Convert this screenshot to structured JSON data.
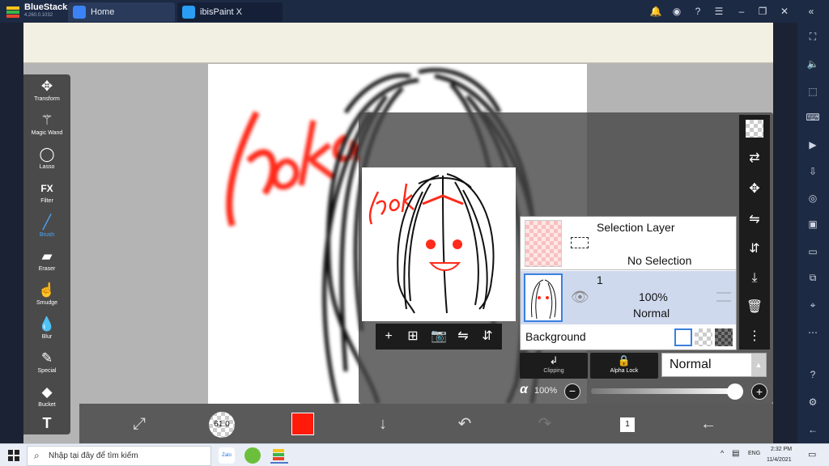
{
  "window": {
    "brand": "BlueStacks",
    "version": "4.260.0.1032",
    "tabs": [
      {
        "label": "Home"
      },
      {
        "label": "ibisPaint X"
      }
    ]
  },
  "tools": [
    {
      "label": "Transform",
      "icon": "move-arrows-icon"
    },
    {
      "label": "Magic Wand",
      "icon": "magic-wand-icon"
    },
    {
      "label": "Lasso",
      "icon": "lasso-icon"
    },
    {
      "label": "Filter",
      "icon": "fx-icon"
    },
    {
      "label": "Brush",
      "icon": "brush-icon",
      "active": true
    },
    {
      "label": "Eraser",
      "icon": "eraser-icon"
    },
    {
      "label": "Smudge",
      "icon": "smudge-icon"
    },
    {
      "label": "Blur",
      "icon": "blur-drop-icon"
    },
    {
      "label": "Special",
      "icon": "special-icon"
    },
    {
      "label": "Bucket",
      "icon": "bucket-icon"
    }
  ],
  "bottombar": {
    "brush_size": "61.0",
    "color": "#ff1a0a",
    "layer_count": "1"
  },
  "layers": {
    "selection_layer": {
      "title": "Selection Layer",
      "status": "No Selection"
    },
    "layer1": {
      "name": "1",
      "opacity": "100%",
      "blend": "Normal"
    },
    "background": {
      "label": "Background"
    }
  },
  "blend": {
    "clipping_label": "Clipping",
    "alpha_lock_label": "Alpha Lock",
    "mode": "Normal"
  },
  "alpha": {
    "symbol": "α",
    "value": "100%",
    "level": 1.0
  },
  "taskbar": {
    "search_placeholder": "Nhập tại đây để tìm kiếm",
    "lang": "ENG",
    "time": "2:32 PM",
    "date": "11/4/2021"
  },
  "colors": {
    "accent": "#4aa8ff",
    "selected_row": "#cfd9ee",
    "ink_red": "#ff2a1a"
  }
}
